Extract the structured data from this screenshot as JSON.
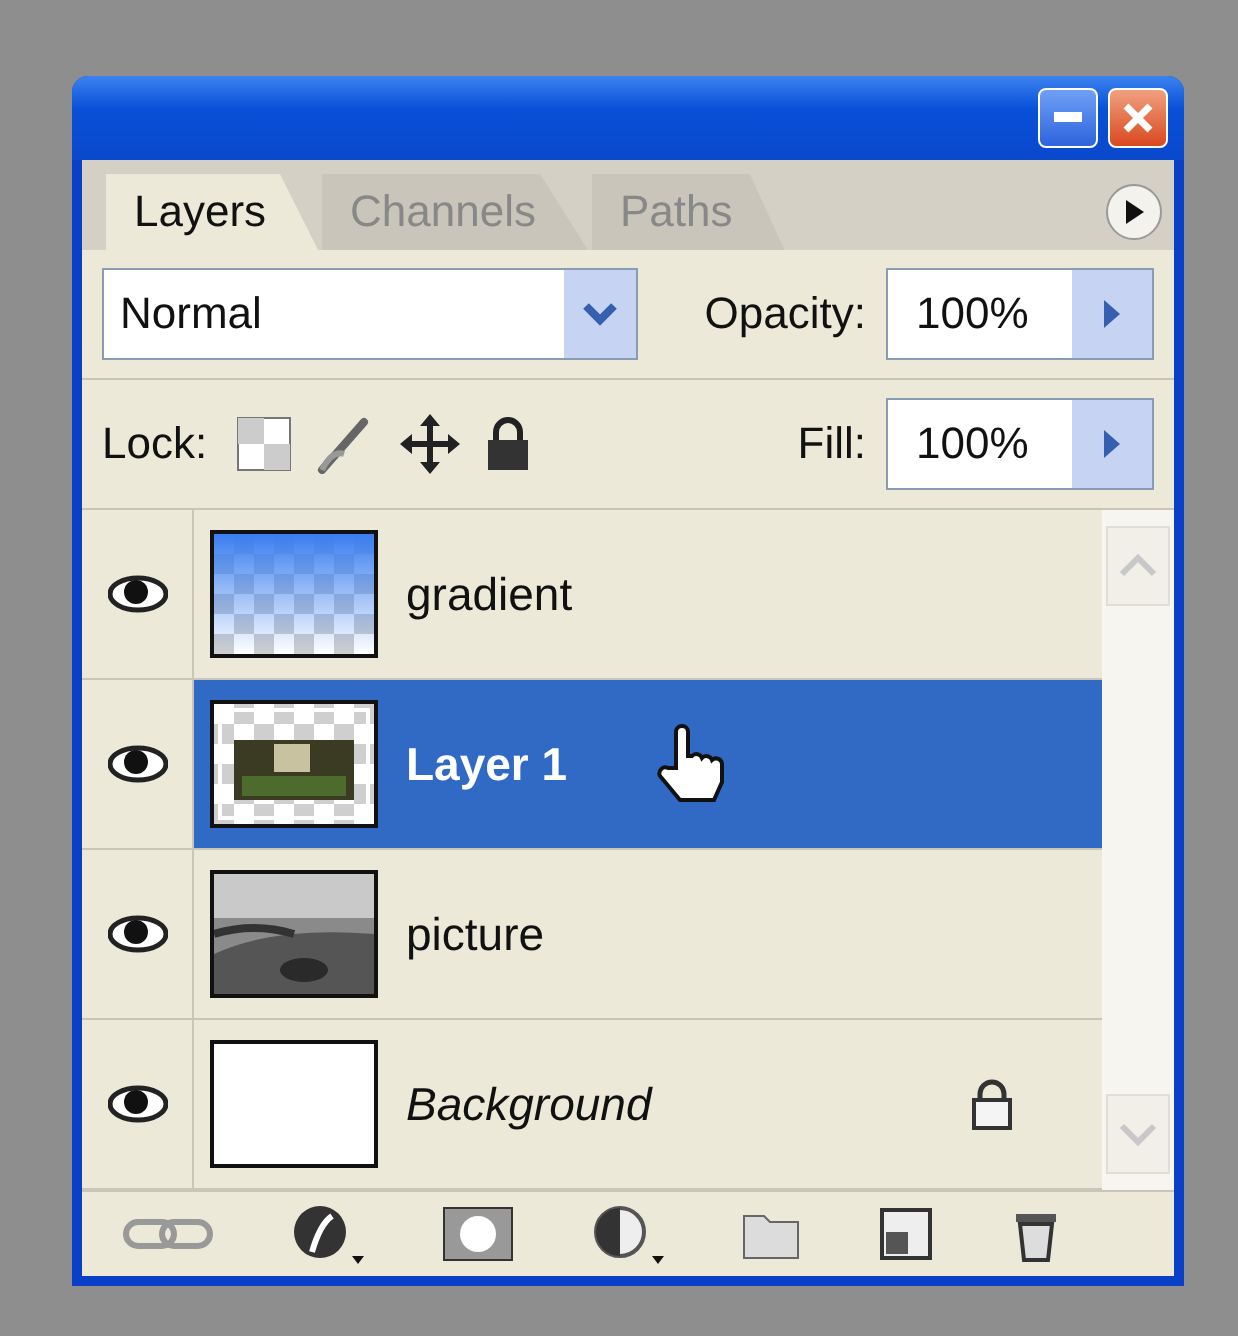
{
  "tabs": [
    {
      "label": "Layers",
      "selected": true
    },
    {
      "label": "Channels",
      "selected": false
    },
    {
      "label": "Paths",
      "selected": false
    }
  ],
  "blend_mode": "Normal",
  "opacity": {
    "label": "Opacity:",
    "value": "100%"
  },
  "lock": {
    "label": "Lock:"
  },
  "fill": {
    "label": "Fill:",
    "value": "100%"
  },
  "layers": [
    {
      "name": "gradient",
      "kind": "gradient",
      "visible": true,
      "selected": false,
      "locked": false,
      "italic": false,
      "hovered": false
    },
    {
      "name": "Layer 1",
      "kind": "cutout",
      "visible": true,
      "selected": true,
      "locked": false,
      "italic": false,
      "hovered": true
    },
    {
      "name": "picture",
      "visible": true,
      "selected": false,
      "locked": false,
      "italic": false,
      "hovered": false
    },
    {
      "name": "Background",
      "kind": "white",
      "visible": true,
      "selected": false,
      "locked": true,
      "italic": true,
      "hovered": false
    }
  ]
}
